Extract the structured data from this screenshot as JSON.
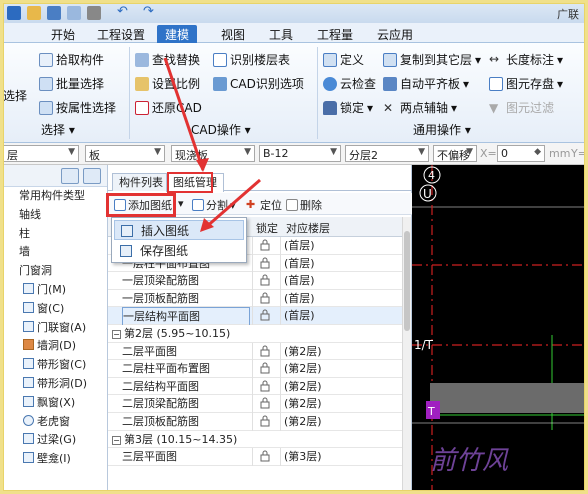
{
  "title_bar": {
    "right_text": "广联"
  },
  "menu": {
    "items": [
      "开始",
      "工程设置",
      "建模",
      "视图",
      "工具",
      "工程量",
      "云应用"
    ],
    "active": "建模"
  },
  "ribbon": {
    "left_fragment": "选择",
    "select_group": {
      "items": [
        "拾取构件",
        "批量选择",
        "按属性选择"
      ],
      "label": "选择"
    },
    "cad_group": {
      "items": [
        "查找替换",
        "识别楼层表",
        "设置比例",
        "CAD识别选项",
        "还原CAD"
      ],
      "label": "CAD操作"
    },
    "general_group": {
      "items": [
        "定义",
        "复制到其它层",
        "长度标注",
        "云检查",
        "自动平齐板",
        "图元存盘",
        "锁定",
        "两点辅轴",
        "图元过滤"
      ],
      "label": "通用操作"
    }
  },
  "property_bar": {
    "combos": [
      "层",
      "板",
      "现浇板",
      "B-12",
      "分层2",
      "不偏移"
    ],
    "x_label": "X=",
    "x_value": "0",
    "unit": "mm",
    "y_label": "Y="
  },
  "left_tree": {
    "items": [
      "常用构件类型",
      "轴线",
      "柱",
      "墙",
      "门窗洞",
      "门(M)",
      "窗(C)",
      "门联窗(A)",
      "墙洞(D)",
      "带形窗(C)",
      "带形洞(D)",
      "飘窗(X)",
      "老虎窗",
      "过梁(G)",
      "壁龛(I)"
    ]
  },
  "center": {
    "tabs": [
      "构件列表",
      "图纸管理"
    ],
    "active_tab": "图纸管理",
    "toolbar": {
      "add": "添加图纸",
      "split": "分割",
      "locate": "定位",
      "delete": "删除"
    },
    "grid_headers": {
      "lock": "锁定",
      "floor": "对应楼层"
    },
    "rows": [
      {
        "name": "一层平面图",
        "floor": "(首层)",
        "type": "sheet"
      },
      {
        "name": "一层柱平面布置图",
        "floor": "(首层)",
        "type": "sheet"
      },
      {
        "name": "一层顶梁配筋图",
        "floor": "(首层)",
        "type": "sheet"
      },
      {
        "name": "一层顶板配筋图",
        "floor": "(首层)",
        "type": "sheet"
      },
      {
        "name": "一层结构平面图",
        "floor": "(首层)",
        "type": "sheet",
        "selected": true
      },
      {
        "name": "第2层 (5.95~10.15)",
        "floor": "",
        "type": "floor"
      },
      {
        "name": "二层平面图",
        "floor": "(第2层)",
        "type": "sheet"
      },
      {
        "name": "二层柱平面布置图",
        "floor": "(第2层)",
        "type": "sheet"
      },
      {
        "name": "二层结构平面图",
        "floor": "(第2层)",
        "type": "sheet"
      },
      {
        "name": "二层顶梁配筋图",
        "floor": "(第2层)",
        "type": "sheet"
      },
      {
        "name": "二层顶板配筋图",
        "floor": "(第2层)",
        "type": "sheet"
      },
      {
        "name": "第3层 (10.15~14.35)",
        "floor": "",
        "type": "floor"
      },
      {
        "name": "三层平面图",
        "floor": "(第3层)",
        "type": "sheet"
      }
    ]
  },
  "dropdown": {
    "items": [
      "插入图纸",
      "保存图纸"
    ],
    "hover": "插入图纸"
  },
  "canvas": {
    "labels": [
      "4",
      "U",
      "1/T",
      "T"
    ]
  },
  "watermark": "前竹风",
  "colors": {
    "accent": "#2f73c8",
    "annotation": "#e23232",
    "canvas_bg": "#000000",
    "grid_green": "#33cc33",
    "magenta": "#b020c0"
  }
}
